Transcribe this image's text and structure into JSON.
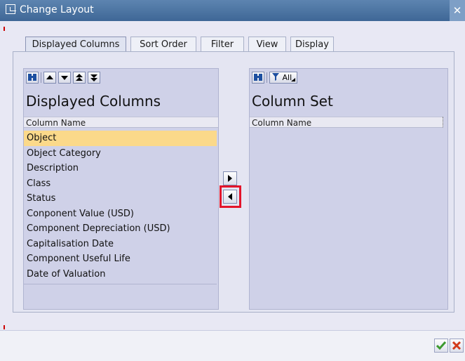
{
  "window": {
    "title": "Change Layout",
    "close_glyph": "✕"
  },
  "tabs": [
    {
      "label": "Displayed Columns",
      "active": true
    },
    {
      "label": "Sort Order",
      "active": false
    },
    {
      "label": "Filter",
      "active": false
    },
    {
      "label": "View",
      "active": false
    },
    {
      "label": "Display",
      "active": false
    }
  ],
  "left_panel": {
    "title": "Displayed Columns",
    "column_header": "Column Name",
    "toolbar_icons": [
      "find-icon",
      "move-up-icon",
      "move-down-icon",
      "move-top-icon",
      "move-bottom-icon"
    ],
    "rows": [
      {
        "label": "Object",
        "selected": true
      },
      {
        "label": "Object Category",
        "selected": false
      },
      {
        "label": "Description",
        "selected": false
      },
      {
        "label": "Class",
        "selected": false
      },
      {
        "label": "Status",
        "selected": false
      },
      {
        "label": "Conponent Value (USD)",
        "selected": false
      },
      {
        "label": "Component Depreciation (USD)",
        "selected": false
      },
      {
        "label": "Capitalisation Date",
        "selected": false
      },
      {
        "label": "Component Useful Life",
        "selected": false
      },
      {
        "label": "Date of Valuation",
        "selected": false
      }
    ]
  },
  "right_panel": {
    "title": "Column Set",
    "column_header": "Column Name",
    "filter_button_label": "All",
    "toolbar_icons": [
      "find-icon",
      "filter-icon",
      "dropdown-icon"
    ]
  },
  "transfer_buttons": [
    "move-right-icon",
    "move-left-icon"
  ],
  "highlight_color": "#e3152b",
  "bottom_buttons": [
    "confirm-check-icon",
    "cancel-x-icon"
  ],
  "colors": {
    "selected_row": "#fbd98a",
    "titlebar": "#4a72a3",
    "confirm": "#3c9a2e",
    "cancel": "#d23a1a"
  }
}
